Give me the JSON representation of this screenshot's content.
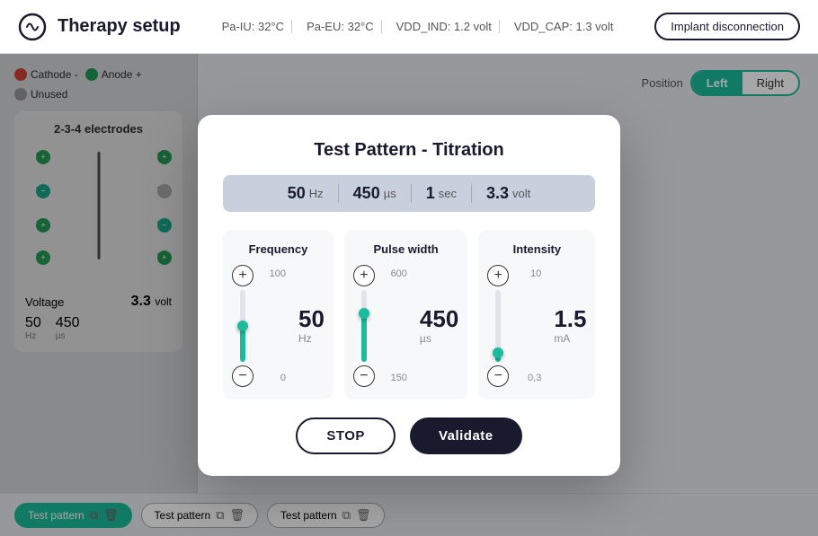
{
  "header": {
    "title": "Therapy setup",
    "stats": [
      {
        "label": "Pa-IU: 32°C"
      },
      {
        "label": "Pa-EU: 32°C"
      },
      {
        "label": "VDD_IND: 1.2 volt"
      },
      {
        "label": "VDD_CAP: 1.3 volt"
      }
    ],
    "implant_btn": "Implant disconnection"
  },
  "position": {
    "label": "Position",
    "left": "Left",
    "right": "Right",
    "active": "Left"
  },
  "left_panel": {
    "cathode_label": "Cathode -",
    "anode_label": "Anode +",
    "unused_label": "Unused",
    "section1_title": "2-3-4 electrodes",
    "section2_title": "2-",
    "voltage_label": "Voltage",
    "voltage_value": "3.3",
    "voltage_unit": "volt",
    "freq_value": "50",
    "freq_unit": "Hz",
    "pulse_value": "450",
    "pulse_unit": "µs"
  },
  "bottom_bar": {
    "tabs": [
      {
        "label": "Test pattern",
        "active": true
      },
      {
        "label": "Test pattern",
        "active": false
      },
      {
        "label": "Test pattern",
        "active": false
      }
    ]
  },
  "modal": {
    "title": "Test Pattern - Titration",
    "summary": {
      "freq_val": "50",
      "freq_unit": "Hz",
      "pulse_val": "450",
      "pulse_unit": "µs",
      "dur_val": "1",
      "dur_unit": "sec",
      "volt_val": "3.3",
      "volt_unit": "volt"
    },
    "columns": [
      {
        "header": "Frequency",
        "max": "100",
        "min": "0",
        "value": "50",
        "unit": "Hz",
        "fill_pct": 50,
        "thumb_pct": 50
      },
      {
        "header": "Pulse width",
        "max": "600",
        "min": "150",
        "value": "450",
        "unit": "µs",
        "fill_pct": 67,
        "thumb_pct": 67
      },
      {
        "header": "Intensity",
        "max": "10",
        "min": "0,3",
        "value": "1.5",
        "unit": "mA",
        "fill_pct": 12,
        "thumb_pct": 12
      }
    ],
    "stop_btn": "STOP",
    "validate_btn": "Validate"
  }
}
